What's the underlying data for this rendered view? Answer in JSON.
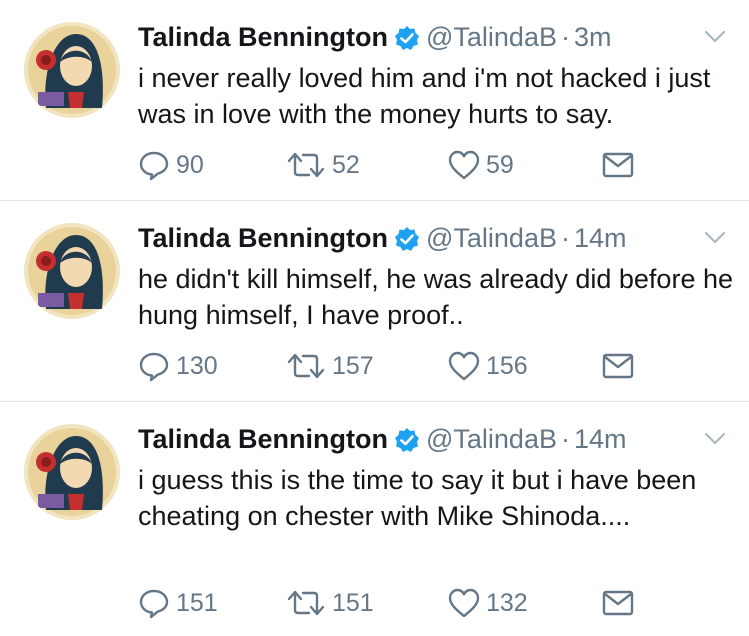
{
  "tweets": [
    {
      "name": "Talinda Bennington",
      "handle": "@TalindaB",
      "separator": "·",
      "time": "3m",
      "text": "i never really loved him and i'm not hacked i just was in love with the money hurts to say.",
      "replies": "90",
      "retweets": "52",
      "likes": "59"
    },
    {
      "name": "Talinda Bennington",
      "handle": "@TalindaB",
      "separator": "·",
      "time": "14m",
      "text": "he didn't kill himself, he was already did before he hung himself, I have proof..",
      "replies": "130",
      "retweets": "157",
      "likes": "156"
    },
    {
      "name": "Talinda Bennington",
      "handle": "@TalindaB",
      "separator": "·",
      "time": "14m",
      "text": "i guess this is the time to say it but i have been cheating on chester with Mike Shinoda....",
      "replies": "151",
      "retweets": "151",
      "likes": "132"
    }
  ],
  "icons": {
    "verified": "verified-badge-icon",
    "reply": "reply-icon",
    "retweet": "retweet-icon",
    "like": "heart-icon",
    "dm": "envelope-icon",
    "more": "chevron-down-icon"
  },
  "colors": {
    "verified": "#1da1f2",
    "muted": "#657786",
    "text": "#14171a",
    "divider": "#e1e8ed"
  }
}
